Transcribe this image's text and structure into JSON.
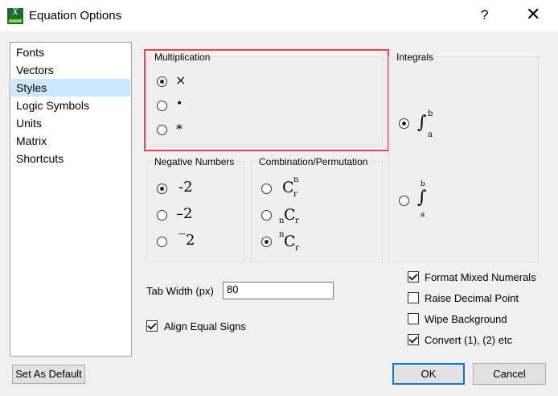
{
  "window": {
    "title": "Equation Options",
    "app_icon_text": "X",
    "help_label": "?",
    "close_label": "✕"
  },
  "sidebar": {
    "items": [
      {
        "label": "Fonts"
      },
      {
        "label": "Vectors"
      },
      {
        "label": "Styles",
        "selected": true
      },
      {
        "label": "Logic Symbols"
      },
      {
        "label": "Units"
      },
      {
        "label": "Matrix"
      },
      {
        "label": "Shortcuts"
      }
    ]
  },
  "multiplication": {
    "label": "Multiplication",
    "options": [
      "×",
      "•",
      "*"
    ],
    "selected_index": 0
  },
  "negative_numbers": {
    "label": "Negative Numbers",
    "options": [
      "-2",
      "–2",
      "‾2"
    ],
    "selected_index": 0
  },
  "combination": {
    "label": "Combination/Permutation",
    "options": [
      {
        "sup": "n",
        "base": "C",
        "sub": "r"
      },
      {
        "pre": "n",
        "base": "C",
        "sub": "r"
      },
      {
        "presup": "n",
        "base": "C",
        "sub": "r"
      }
    ],
    "selected_index": 2
  },
  "integrals": {
    "label": "Integrals",
    "options": [
      {
        "symbol": "∫",
        "upper": "b",
        "lower": "a"
      },
      {
        "symbol": "∫",
        "upper": "b",
        "lower": "a"
      }
    ],
    "selected_index": 0
  },
  "tab_width": {
    "label": "Tab Width (px)",
    "value": "80"
  },
  "align_equal_signs": {
    "label": "Align Equal Signs",
    "checked": true
  },
  "checkboxes": [
    {
      "label": "Format Mixed Numerals",
      "checked": true
    },
    {
      "label": "Raise Decimal Point",
      "checked": false
    },
    {
      "label": "Wipe Background",
      "checked": false
    },
    {
      "label": "Convert (1), (2) etc",
      "checked": true
    }
  ],
  "buttons": {
    "set_default": "Set As Default",
    "ok": "OK",
    "cancel": "Cancel"
  },
  "colors": {
    "highlight": "#e8474c",
    "selection": "#cce8ff",
    "accent": "#0078d7"
  }
}
